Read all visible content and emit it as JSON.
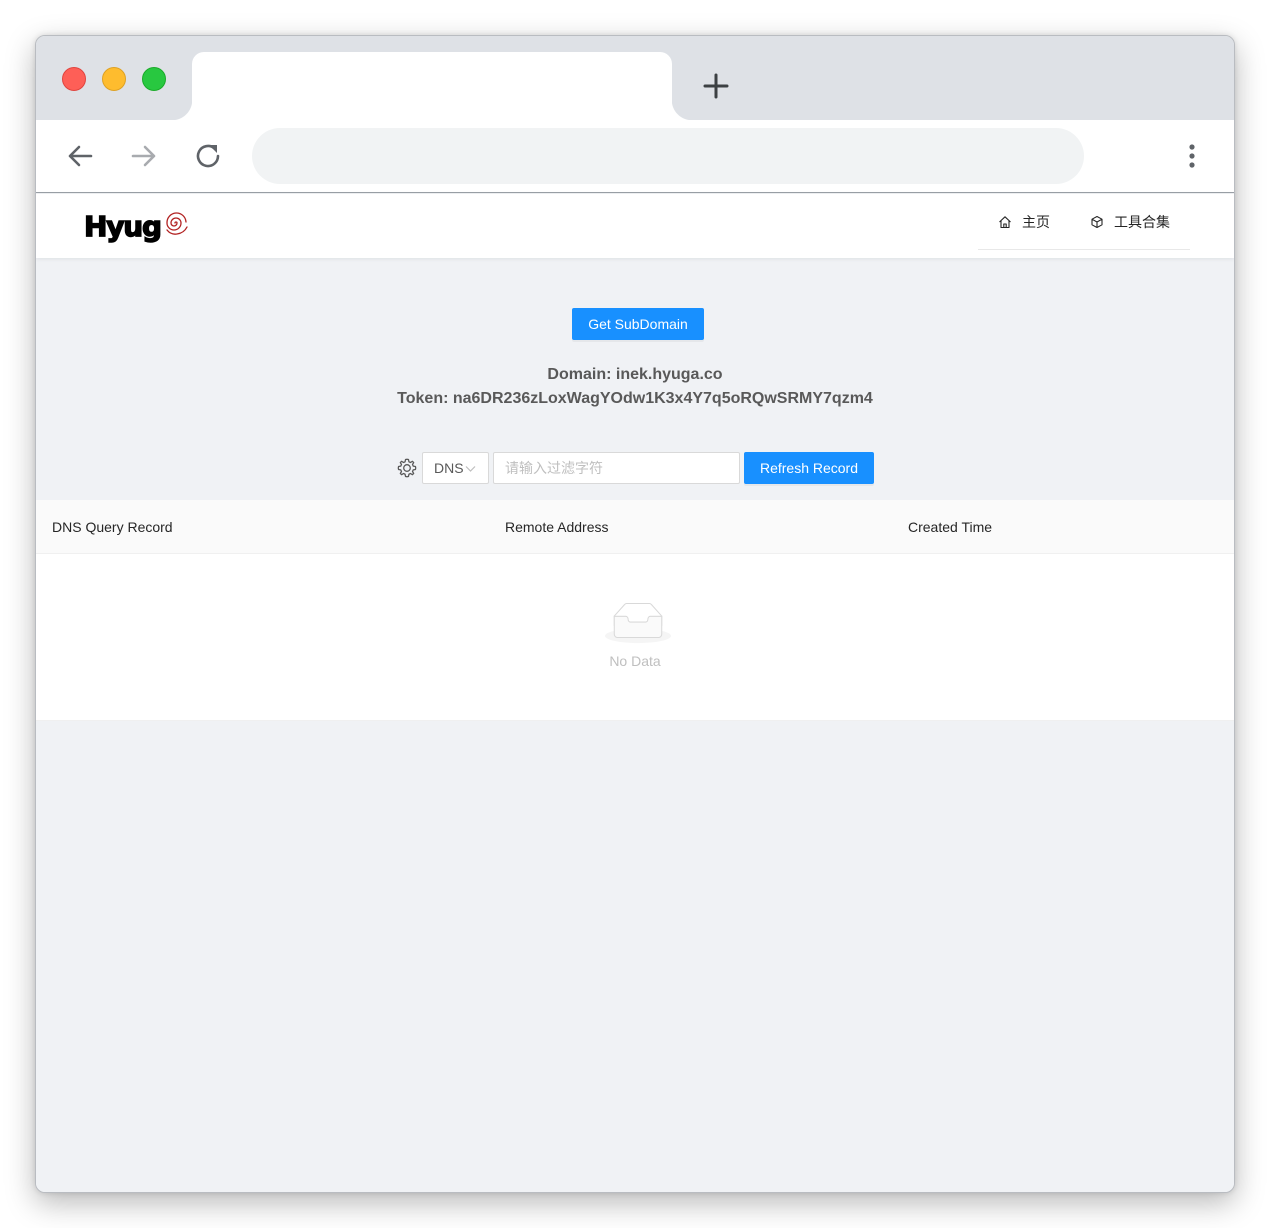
{
  "browser": {
    "tab_title": "",
    "address_value": "",
    "address_placeholder": ""
  },
  "header": {
    "logo_text": "Hyug",
    "nav": [
      {
        "label": "主页",
        "icon": "home-icon"
      },
      {
        "label": "工具合集",
        "icon": "cube-icon"
      }
    ]
  },
  "main": {
    "get_subdomain_label": "Get SubDomain",
    "domain_line": "Domain: inek.hyuga.co",
    "token_line": "Token: na6DR236zLoxWagYOdw1K3x4Y7q5oRQwSRMY7qzm4",
    "filter": {
      "type_selected": "DNS",
      "input_placeholder": "请输入过滤字符",
      "input_value": "",
      "refresh_label": "Refresh Record"
    },
    "table": {
      "columns": [
        "DNS Query Record",
        "Remote Address",
        "Created Time"
      ],
      "rows": [],
      "empty_text": "No Data"
    }
  },
  "colors": {
    "primary": "#1890ff",
    "page_bg": "#f0f2f5"
  }
}
